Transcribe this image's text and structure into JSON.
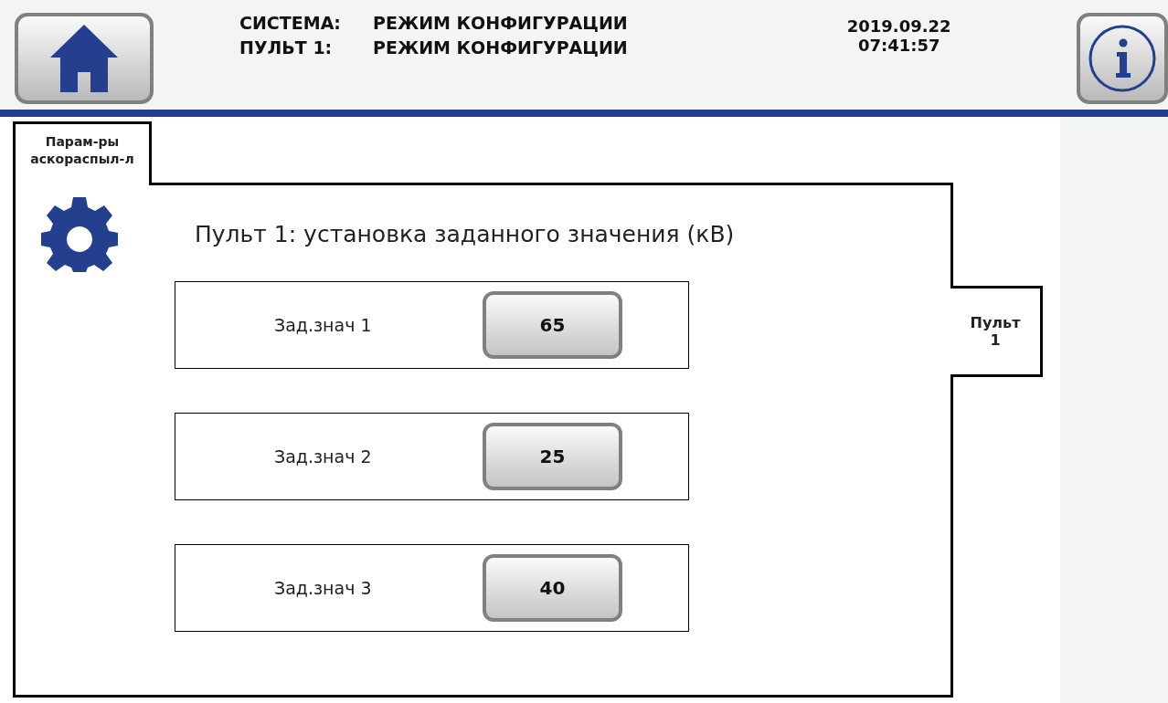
{
  "header": {
    "status_rows": [
      {
        "label": "СИСТЕМА:",
        "value": "РЕЖИМ КОНФИГУРАЦИИ"
      },
      {
        "label": "ПУЛЬТ 1:",
        "value": "РЕЖИМ КОНФИГУРАЦИИ"
      }
    ],
    "date": "2019.09.22",
    "time": "07:41:57"
  },
  "tabs": [
    {
      "label": "Парам-ры аскораспыл-л",
      "selected": true
    }
  ],
  "side_tabs": [
    {
      "label": "Пульт 1",
      "selected": true
    }
  ],
  "panel": {
    "title": "Пульт 1: установка заданного значения (кВ)",
    "setpoints": [
      {
        "label": "Зад.знач 1",
        "value": "65"
      },
      {
        "label": "Зад.знач 2",
        "value": "25"
      },
      {
        "label": "Зад.знач 3",
        "value": "40"
      }
    ]
  }
}
